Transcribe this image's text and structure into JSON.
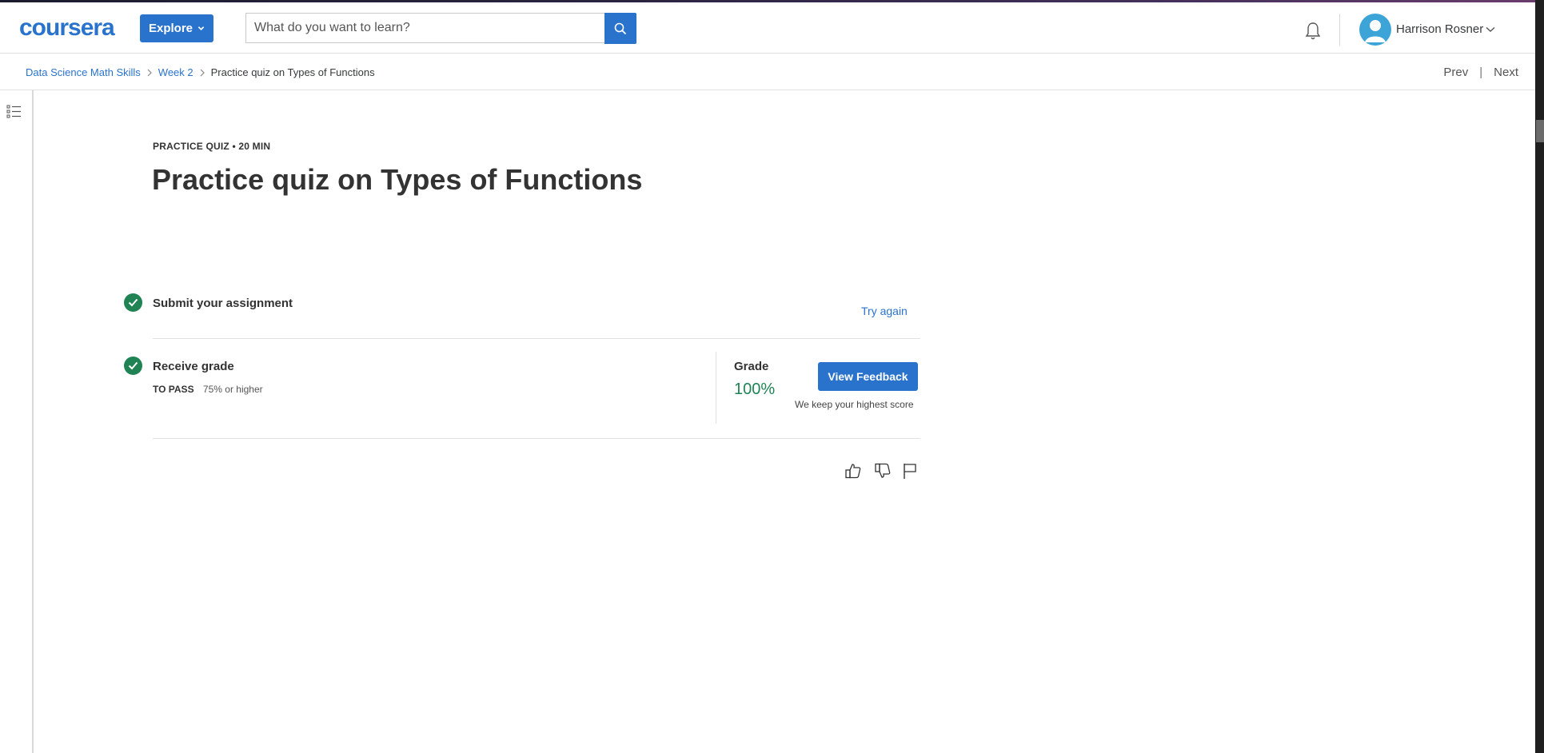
{
  "header": {
    "logo_text": "coursera",
    "explore_label": "Explore",
    "search_placeholder": "What do you want to learn?",
    "user_name": "Harrison Rosner"
  },
  "breadcrumb": {
    "items": [
      "Data Science Math Skills",
      "Week 2",
      "Practice quiz on Types of Functions"
    ],
    "prev_label": "Prev",
    "next_label": "Next"
  },
  "quiz": {
    "kicker": "PRACTICE QUIZ • 20 MIN",
    "title": "Practice quiz on Types of Functions",
    "steps": [
      {
        "title": "Submit your assignment",
        "action": "Try again"
      },
      {
        "title": "Receive grade",
        "pass_label": "TO PASS",
        "pass_value": "75% or higher"
      }
    ],
    "grade_label": "Grade",
    "grade_value": "100%",
    "view_feedback_label": "View Feedback",
    "keep_score_note": "We keep your highest score"
  },
  "colors": {
    "brand_blue": "#2a73cc",
    "success_green": "#1f8354",
    "text_dark": "#333333"
  },
  "icons": [
    "menu-list-icon",
    "search-icon",
    "bell-icon",
    "avatar-icon",
    "chevron-down-icon",
    "chevron-right-icon",
    "check-icon",
    "thumbs-up-icon",
    "thumbs-down-icon",
    "flag-icon"
  ]
}
